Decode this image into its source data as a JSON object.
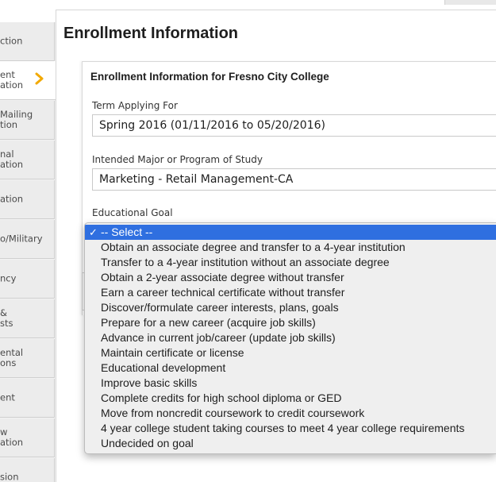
{
  "page": {
    "title": "Enrollment Information"
  },
  "sidebar": {
    "items": [
      {
        "label": "ction"
      },
      {
        "label": "ent\nation",
        "active": true
      },
      {
        "label": "Mailing\ntion"
      },
      {
        "label": "nal\nation"
      },
      {
        "label": "ation"
      },
      {
        "label": "o/Military"
      },
      {
        "label": "ncy"
      },
      {
        "label": "&\nsts"
      },
      {
        "label": "ental\nons"
      },
      {
        "label": "ent"
      },
      {
        "label": "w\nation"
      },
      {
        "label": "sion"
      }
    ]
  },
  "panel": {
    "title": "Enrollment Information for Fresno City College",
    "term": {
      "label": "Term Applying For",
      "value": "Spring 2016 (01/11/2016 to 05/20/2016)"
    },
    "major": {
      "label": "Intended Major or Program of Study",
      "value": "Marketing - Retail Management-CA"
    },
    "goal": {
      "label": "Educational Goal"
    }
  },
  "dropdown": {
    "selected_mark": "✓",
    "options": [
      "-- Select --",
      "Obtain an associate degree and transfer to a 4-year institution",
      "Transfer to a 4-year institution without an associate degree",
      "Obtain a 2-year associate degree without transfer",
      "Earn a career technical certificate without transfer",
      "Discover/formulate career interests, plans, goals",
      "Prepare for a new career (acquire job skills)",
      "Advance in current job/career (update job skills)",
      "Maintain certificate or license",
      "Educational development",
      "Improve basic skills",
      "Complete credits for high school diploma or GED",
      "Move from noncredit coursework to credit coursework",
      "4 year college student taking courses to meet 4 year college requirements",
      "Undecided on goal"
    ]
  },
  "colors": {
    "accent_chevron": "#f2a900",
    "selected_option": "#2f6fe0"
  }
}
